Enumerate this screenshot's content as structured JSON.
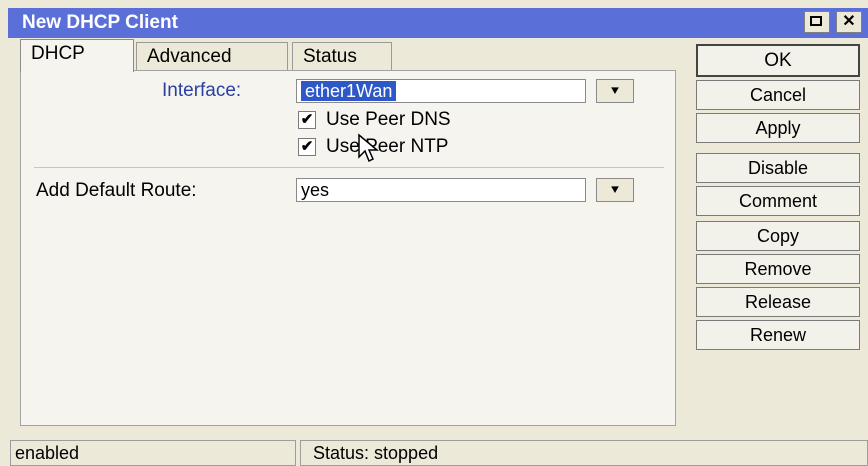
{
  "window": {
    "title": "New DHCP Client",
    "close_glyph": "✕"
  },
  "tabs": [
    {
      "label": "DHCP"
    },
    {
      "label": "Advanced"
    },
    {
      "label": "Status"
    }
  ],
  "form": {
    "interface": {
      "label": "Interface:",
      "value": "ether1Wan"
    },
    "use_peer_dns": {
      "label": "Use Peer DNS",
      "checked": true
    },
    "use_peer_ntp": {
      "label": "Use Peer NTP",
      "checked": true
    },
    "add_default_route": {
      "label": "Add Default Route:",
      "value": "yes"
    },
    "dropdown_glyph": "⯆",
    "check_glyph": "✔"
  },
  "buttons": {
    "ok": "OK",
    "cancel": "Cancel",
    "apply": "Apply",
    "disable": "Disable",
    "comment": "Comment",
    "copy": "Copy",
    "remove": "Remove",
    "release": "Release",
    "renew": "Renew"
  },
  "statusbar": {
    "left": "enabled",
    "right": "Status: stopped"
  },
  "colors": {
    "titlebar": "#5b6fd9",
    "selection": "#2e58c8",
    "label_accent": "#2b3fa3"
  }
}
